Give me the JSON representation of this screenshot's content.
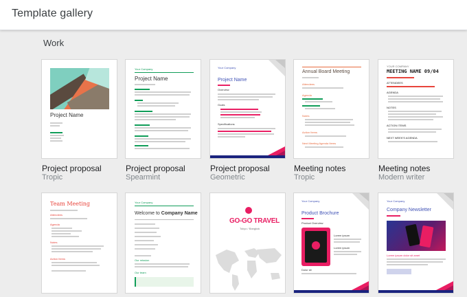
{
  "header": {
    "title": "Template gallery"
  },
  "section": {
    "title": "Work"
  },
  "templates": [
    {
      "name": "Project proposal",
      "style": "Tropic"
    },
    {
      "name": "Project proposal",
      "style": "Spearmint"
    },
    {
      "name": "Project proposal",
      "style": "Geometric"
    },
    {
      "name": "Meeting notes",
      "style": "Tropic"
    },
    {
      "name": "Meeting notes",
      "style": "Modern writer"
    }
  ],
  "thumbs": {
    "t1": {
      "title": "Project Name"
    },
    "t2": {
      "company": "Your Company",
      "title": "Project Name"
    },
    "t3": {
      "company": "Your Company",
      "title": "Project Name",
      "h1": "Overview",
      "h2": "Goals",
      "h3": "Specifications"
    },
    "t4": {
      "title": "Annual Board Meeting",
      "h1": "Attendees",
      "h2": "Agenda",
      "h3": "Notes",
      "h4": "Action Items",
      "h5": "Next Meeting Agenda Items"
    },
    "t5": {
      "company": "YOUR COMPANY",
      "title": "MEETING NAME 09/04",
      "h1": "ATTENDEES",
      "h2": "AGENDA",
      "h3": "NOTES",
      "h4": "ACTION ITEMS",
      "h5": "NEXT WEEK'S AGENDA"
    },
    "t6": {
      "title": "Team Meeting",
      "h1": "Attendees",
      "h2": "Agenda",
      "h3": "Notes",
      "h4": "Action Items"
    },
    "t7": {
      "company": "Your Company",
      "title_pre": "Welcome to ",
      "title_bold": "Company Name",
      "h1": "Our mission",
      "h2": "Our team"
    },
    "t8": {
      "title": "GO-GO TRAVEL",
      "sub": "Tokyo / Bangkok"
    },
    "t9": {
      "company": "Your Company",
      "title": "Product Brochure",
      "h1": "Product Overview",
      "h2": "Lorem ipsum",
      "h3": "Lorem ipsum",
      "h4": "Dolor sit"
    },
    "t10": {
      "company": "Your Company",
      "title": "Company Newsletter",
      "h1": "Lorem ipsum dolor sit amet"
    }
  },
  "colors": {
    "accent_red": "#e8453c",
    "accent_green": "#0f9d58",
    "accent_blue": "#3f51b5",
    "tropic_mint": "#8bd5c6",
    "tropic_orange": "#e86a3e",
    "pink": "#e91e63",
    "navy": "#1a237e"
  }
}
